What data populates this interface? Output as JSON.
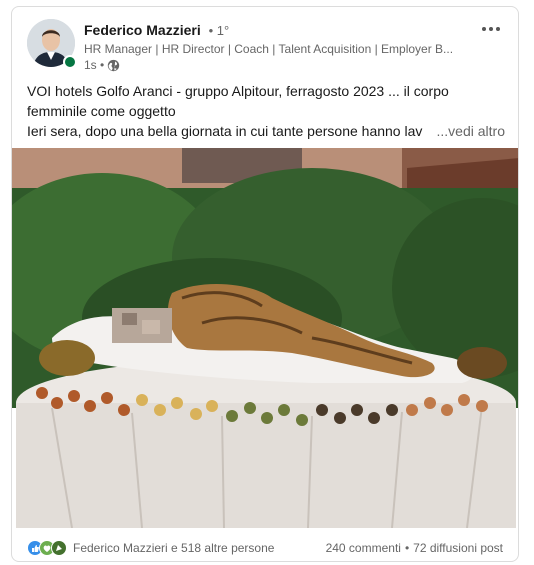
{
  "post": {
    "author": {
      "name": "Federico Mazzieri",
      "degree": "• 1°",
      "headline": "HR Manager | HR Director | Coach | Talent Acquisition | Employer B...",
      "time": "1s •"
    },
    "text": {
      "line1": "VOI hotels Golfo Aranci - gruppo Alpitour, ferragosto 2023 ... il corpo",
      "line2": "femminile come oggetto",
      "line3": "Ieri sera, dopo una bella giornata in cui tante persone hanno lav",
      "see_more": "...vedi altro"
    },
    "social": {
      "reactions_text": "Federico Mazzieri e 518 altre persone",
      "comments": "240 commenti",
      "separator": "•",
      "reposts": "72 diffusioni post"
    },
    "colors": {
      "presence": "#057642",
      "like": "#378fe9",
      "support": "#6dae4f",
      "celebrate": "#44712e"
    },
    "icons": [
      "more-options-icon",
      "globe-icon",
      "like-reaction-icon",
      "support-reaction-icon",
      "celebrate-reaction-icon"
    ]
  }
}
